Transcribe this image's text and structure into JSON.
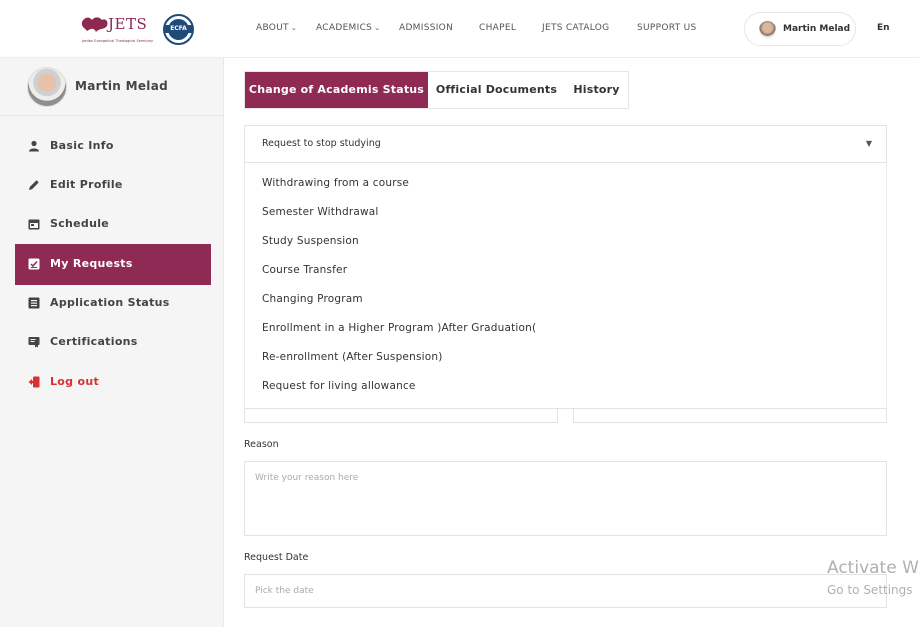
{
  "header": {
    "logo_word": "JETS",
    "logo_tagline": "Jordan Evangelical Theological Seminary",
    "partner_logo_text": "ECFA",
    "nav": [
      {
        "label": "ABOUT",
        "has_dropdown": true
      },
      {
        "label": "ACADEMICS",
        "has_dropdown": true
      },
      {
        "label": "ADMISSION",
        "has_dropdown": false
      },
      {
        "label": "CHAPEL",
        "has_dropdown": false
      },
      {
        "label": "JETS CATALOG",
        "has_dropdown": false
      },
      {
        "label": "SUPPORT US",
        "has_dropdown": false
      }
    ],
    "user_name": "Martin Melad",
    "language": "En"
  },
  "sidebar": {
    "profile_name": "Martin Melad",
    "items": [
      {
        "label": "Basic Info",
        "icon": "user-icon"
      },
      {
        "label": "Edit Profile",
        "icon": "pencil-icon"
      },
      {
        "label": "Schedule",
        "icon": "calendar-icon"
      },
      {
        "label": "My Requests",
        "icon": "checklist-icon",
        "active": true
      },
      {
        "label": "Application Status",
        "icon": "list-icon"
      },
      {
        "label": "Certifications",
        "icon": "certificate-icon"
      },
      {
        "label": "Log out",
        "icon": "logout-icon"
      }
    ]
  },
  "tabs": [
    {
      "label": "Change of Academis Status",
      "active": true
    },
    {
      "label": "Official Documents"
    },
    {
      "label": "History"
    }
  ],
  "request_select": {
    "value": "Request to stop studying",
    "options": [
      "Withdrawing from a course",
      "Semester Withdrawal",
      "Study Suspension",
      "Course Transfer",
      "Changing Program",
      "Enrollment in a Higher Program )After Graduation(",
      "Re-enrollment (After Suspension)",
      "Request for living allowance"
    ]
  },
  "reason": {
    "label": "Reason",
    "placeholder": "Write your reason here"
  },
  "request_date": {
    "label": "Request Date",
    "placeholder": "Pick the date"
  },
  "watermark": {
    "line1": "Activate W",
    "line2": "Go to Settings"
  },
  "colors": {
    "brand": "#8f2a55",
    "logout": "#d83232"
  }
}
